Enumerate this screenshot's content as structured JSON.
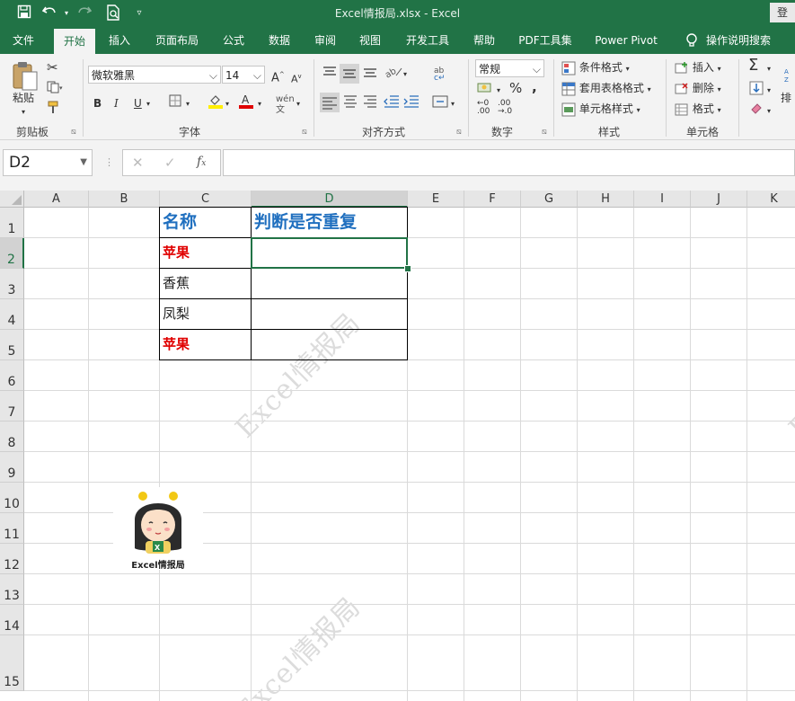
{
  "titlebar": {
    "title": "Excel情报局.xlsx  -  Excel",
    "login": "登"
  },
  "tabs": [
    {
      "label": "文件"
    },
    {
      "label": "开始"
    },
    {
      "label": "插入"
    },
    {
      "label": "页面布局"
    },
    {
      "label": "公式"
    },
    {
      "label": "数据"
    },
    {
      "label": "审阅"
    },
    {
      "label": "视图"
    },
    {
      "label": "开发工具"
    },
    {
      "label": "帮助"
    },
    {
      "label": "PDF工具集"
    },
    {
      "label": "Power Pivot"
    },
    {
      "label": "操作说明搜索"
    }
  ],
  "ribbon": {
    "clipboard": {
      "paste": "粘贴",
      "label": "剪贴板"
    },
    "font": {
      "name": "微软雅黑",
      "size": "14",
      "label": "字体"
    },
    "alignment": {
      "label": "对齐方式"
    },
    "number": {
      "format": "常规",
      "label": "数字"
    },
    "styles": {
      "conditional": "条件格式",
      "table": "套用表格格式",
      "cell": "单元格样式",
      "label": "样式"
    },
    "cells": {
      "insert": "插入",
      "delete": "删除",
      "format": "格式",
      "label": "单元格"
    },
    "editing": {
      "sort": "排"
    }
  },
  "formula_bar": {
    "name_box": "D2",
    "formula": ""
  },
  "sheet": {
    "columns": [
      "A",
      "B",
      "C",
      "D",
      "E",
      "F",
      "G",
      "H",
      "I",
      "J",
      "K"
    ],
    "rows": [
      "1",
      "2",
      "3",
      "4",
      "5",
      "6",
      "7",
      "8",
      "9",
      "10",
      "11",
      "12",
      "13",
      "14",
      "15"
    ],
    "selected_cell": "D2",
    "table": {
      "header_name": "名称",
      "header_check": "判断是否重复",
      "items": [
        "苹果",
        "香蕉",
        "凤梨",
        "苹果"
      ]
    },
    "logo_text": "Excel情报局",
    "watermark": "Excel情报局"
  },
  "colors": {
    "excel_green": "#217346",
    "header_blue": "#1f6fbf",
    "duplicate_red": "#e00000"
  }
}
